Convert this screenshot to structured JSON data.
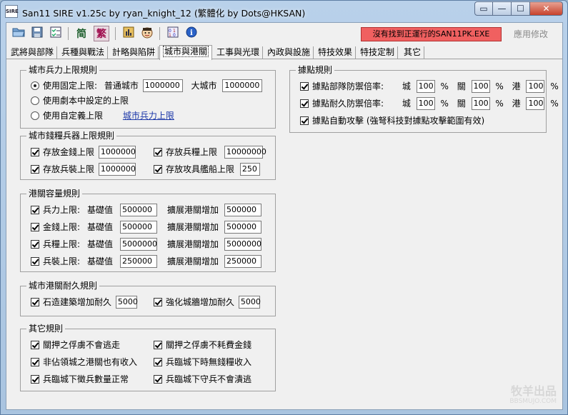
{
  "window": {
    "app_icon_text": "SIRE",
    "title": "San11 SIRE v1.25c by ryan_knight_12 (繁體化 by Dots@HKSAN)",
    "buttons": {
      "restore": "▭",
      "minimize": "—",
      "maximize": "☐",
      "close": "✕"
    }
  },
  "toolbar": {
    "icons": [
      "open-folder-icon",
      "save-icon",
      "checklist-icon",
      "simplified-icon",
      "traditional-icon",
      "stats-icon",
      "character-icon",
      "settings-icon",
      "info-icon"
    ],
    "simplified_label": "简",
    "traditional_label": "繁",
    "info_label": "i",
    "status_text": "沒有找到正運行的SAN11PK.EXE",
    "apply_label": "應用修改",
    "colors": {
      "status_bg": "#f06060",
      "simplified": "#1a5c2a",
      "traditional": "#a01050"
    }
  },
  "tabs": [
    {
      "label": "武將與部隊"
    },
    {
      "label": "兵種與戰法"
    },
    {
      "label": "計略與陷阱"
    },
    {
      "label": "城市與港關"
    },
    {
      "label": "工事與光環"
    },
    {
      "label": "內政與設施"
    },
    {
      "label": "特技效果"
    },
    {
      "label": "特技定制"
    },
    {
      "label": "其它"
    }
  ],
  "active_tab": "城市與港關",
  "city_troop_limit": {
    "title": "城市兵力上限規則",
    "option_fixed": "使用固定上限:",
    "normal_city_label": "普通城市",
    "normal_city_value": "1000000",
    "big_city_label": "大城市",
    "big_city_value": "1000000",
    "option_scenario": "使用劇本中設定的上限",
    "option_custom": "使用自定義上限",
    "custom_link": "城市兵力上限"
  },
  "city_resource_limit": {
    "title": "城市錢糧兵器上限規則",
    "gold_label": "存放金錢上限",
    "gold_value": "1000000",
    "food_label": "存放兵糧上限",
    "food_value": "10000000",
    "equip_label": "存放兵裝上限",
    "equip_value": "1000000",
    "siege_label": "存放攻具艦船上限",
    "siege_value": "250"
  },
  "port_capacity": {
    "title": "港關容量規則",
    "base_label": "基礎值",
    "expand_label": "擴展港關增加",
    "rows": [
      {
        "label": "兵力上限:",
        "base": "500000",
        "expand": "500000"
      },
      {
        "label": "金錢上限:",
        "base": "500000",
        "expand": "500000"
      },
      {
        "label": "兵糧上限:",
        "base": "5000000",
        "expand": "5000000"
      },
      {
        "label": "兵裝上限:",
        "base": "250000",
        "expand": "250000"
      }
    ]
  },
  "durability": {
    "title": "城市港關耐久規則",
    "stone_label": "石造建築增加耐久",
    "stone_value": "5000",
    "wall_label": "強化城牆增加耐久",
    "wall_value": "5000"
  },
  "other_rules": {
    "title": "其它規則",
    "items": [
      "關押之俘虜不會逃走",
      "關押之俘虜不耗費金錢",
      "非佔領城之港關也有收入",
      "兵臨城下時無錢糧收入",
      "兵臨城下徵兵數量正常",
      "兵臨城下守兵不會潰逃"
    ]
  },
  "stronghold": {
    "title": "據點規則",
    "defense_label": "據點部隊防禦倍率:",
    "durability_label": "據點耐久防禦倍率:",
    "city_label": "城",
    "gate_label": "關",
    "port_label": "港",
    "percent": "%",
    "defense_values": [
      "100",
      "100",
      "100"
    ],
    "durability_values": [
      "100",
      "100",
      "100"
    ],
    "auto_attack_label": "據點自動攻擊 (強弩科技對據點攻擊範圍有效)"
  },
  "watermark": {
    "line1": "牧羊出品",
    "line2": "BBSMUJO.COM"
  }
}
